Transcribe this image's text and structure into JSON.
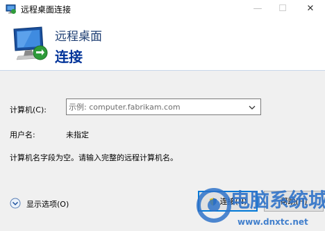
{
  "window": {
    "title": "远程桌面连接",
    "minimize_symbol": "—",
    "maximize_symbol": "☐",
    "close_symbol": "✕"
  },
  "header": {
    "line1": "远程桌面",
    "line2": "连接",
    "icon": "remote-desktop-computer-icon"
  },
  "form": {
    "computer_label": "计算机(C):",
    "computer_placeholder": "示例: computer.fabrikam.com",
    "computer_value": "",
    "username_label": "用户名:",
    "username_value": "未指定",
    "message": "计算机名字段为空。请输入完整的远程计算机名。"
  },
  "footer": {
    "show_options_label": "显示选项(O)",
    "connect_label": "连接(N)",
    "help_label": "帮助(H)"
  },
  "watermark": {
    "text": "电脑系统城",
    "url": "www.dnxtc.net"
  },
  "colors": {
    "title_blue": "#003399",
    "accent": "#0078d7",
    "watermark": "#2f73c9"
  }
}
